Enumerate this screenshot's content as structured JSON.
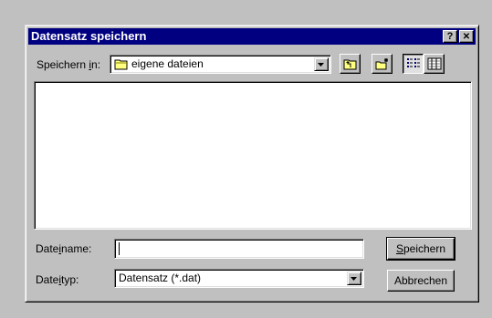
{
  "window": {
    "title": "Datensatz speichern",
    "help_glyph": "?",
    "close_glyph": "✕"
  },
  "save_in": {
    "label_prefix": "Speichern ",
    "label_hotkey": "i",
    "label_suffix": "n:",
    "icon": "folder-icon",
    "value": "eigene dateien"
  },
  "toolbar": {
    "buttons": [
      {
        "icon": "up-one-level-icon"
      },
      {
        "icon": "new-folder-icon"
      },
      {
        "icon": "list-view-icon"
      },
      {
        "icon": "details-view-icon"
      }
    ]
  },
  "file_name": {
    "label_prefix": "Date",
    "label_hotkey": "i",
    "label_suffix": "name:",
    "value": ""
  },
  "file_type": {
    "label_prefix": "Date",
    "label_hotkey": "i",
    "label_suffix": "typ:",
    "value": "Datensatz (*.dat)"
  },
  "buttons": {
    "save_hotkey": "S",
    "save_rest": "peichern",
    "cancel": "Abbrechen"
  },
  "colors": {
    "title_bar": "#000080",
    "face": "#c0c0c0",
    "folder": "#ffff80"
  }
}
